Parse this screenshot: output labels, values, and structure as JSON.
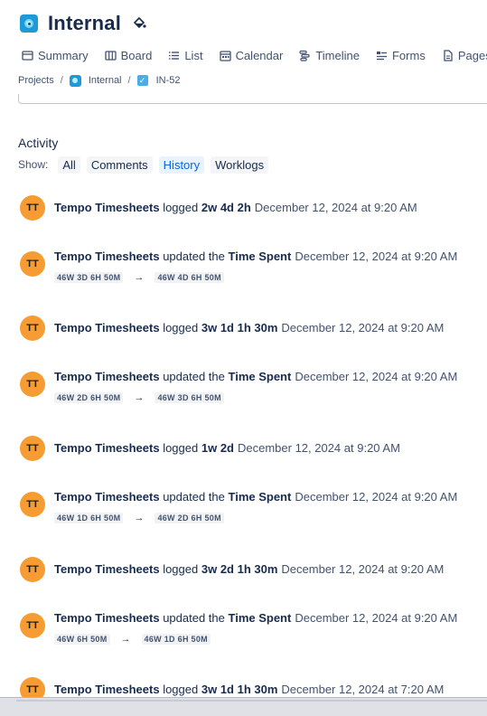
{
  "header": {
    "title": "Internal"
  },
  "tabs": [
    {
      "label": "Summary",
      "icon": "summary-icon"
    },
    {
      "label": "Board",
      "icon": "board-icon"
    },
    {
      "label": "List",
      "icon": "list-icon"
    },
    {
      "label": "Calendar",
      "icon": "calendar-icon"
    },
    {
      "label": "Timeline",
      "icon": "timeline-icon"
    },
    {
      "label": "Forms",
      "icon": "forms-icon"
    },
    {
      "label": "Pages",
      "icon": "pages-icon"
    }
  ],
  "breadcrumb": {
    "root": "Projects",
    "sep": "/",
    "project": "Internal",
    "issue": "IN-52"
  },
  "activity": {
    "title": "Activity",
    "show_label": "Show:",
    "filters": [
      {
        "label": "All",
        "active": false
      },
      {
        "label": "Comments",
        "active": false
      },
      {
        "label": "History",
        "active": true
      },
      {
        "label": "Worklogs",
        "active": false
      }
    ]
  },
  "entries": [
    {
      "avatar": "TT",
      "author": "Tempo Timesheets",
      "verb": "logged",
      "target": "2w 4d 2h",
      "ts": "December 12, 2024 at 9:20 AM"
    },
    {
      "avatar": "TT",
      "author": "Tempo Timesheets",
      "verb": "updated the",
      "target": "Time Spent",
      "ts": "December 12, 2024 at 9:20 AM",
      "from": "46W 3D 6H 50M",
      "to": "46W 4D 6H 50M"
    },
    {
      "avatar": "TT",
      "author": "Tempo Timesheets",
      "verb": "logged",
      "target": "3w 1d 1h 30m",
      "ts": "December 12, 2024 at 9:20 AM"
    },
    {
      "avatar": "TT",
      "author": "Tempo Timesheets",
      "verb": "updated the",
      "target": "Time Spent",
      "ts": "December 12, 2024 at 9:20 AM",
      "from": "46W 2D 6H 50M",
      "to": "46W 3D 6H 50M"
    },
    {
      "avatar": "TT",
      "author": "Tempo Timesheets",
      "verb": "logged",
      "target": "1w 2d",
      "ts": "December 12, 2024 at 9:20 AM"
    },
    {
      "avatar": "TT",
      "author": "Tempo Timesheets",
      "verb": "updated the",
      "target": "Time Spent",
      "ts": "December 12, 2024 at 9:20 AM",
      "from": "46W 1D 6H 50M",
      "to": "46W 2D 6H 50M"
    },
    {
      "avatar": "TT",
      "author": "Tempo Timesheets",
      "verb": "logged",
      "target": "3w 2d 1h 30m",
      "ts": "December 12, 2024 at 9:20 AM"
    },
    {
      "avatar": "TT",
      "author": "Tempo Timesheets",
      "verb": "updated the",
      "target": "Time Spent",
      "ts": "December 12, 2024 at 9:20 AM",
      "from": "46W 6H 50M",
      "to": "46W 1D 6H 50M"
    },
    {
      "avatar": "TT",
      "author": "Tempo Timesheets",
      "verb": "logged",
      "target": "3w 1d 1h 30m",
      "ts": "December 12, 2024 at 7:20 AM"
    }
  ],
  "arrow": "→",
  "colors": {
    "avatar": "#f79b33",
    "active_filter": "#0c66e4",
    "project_icon": "#1d9bd8"
  }
}
